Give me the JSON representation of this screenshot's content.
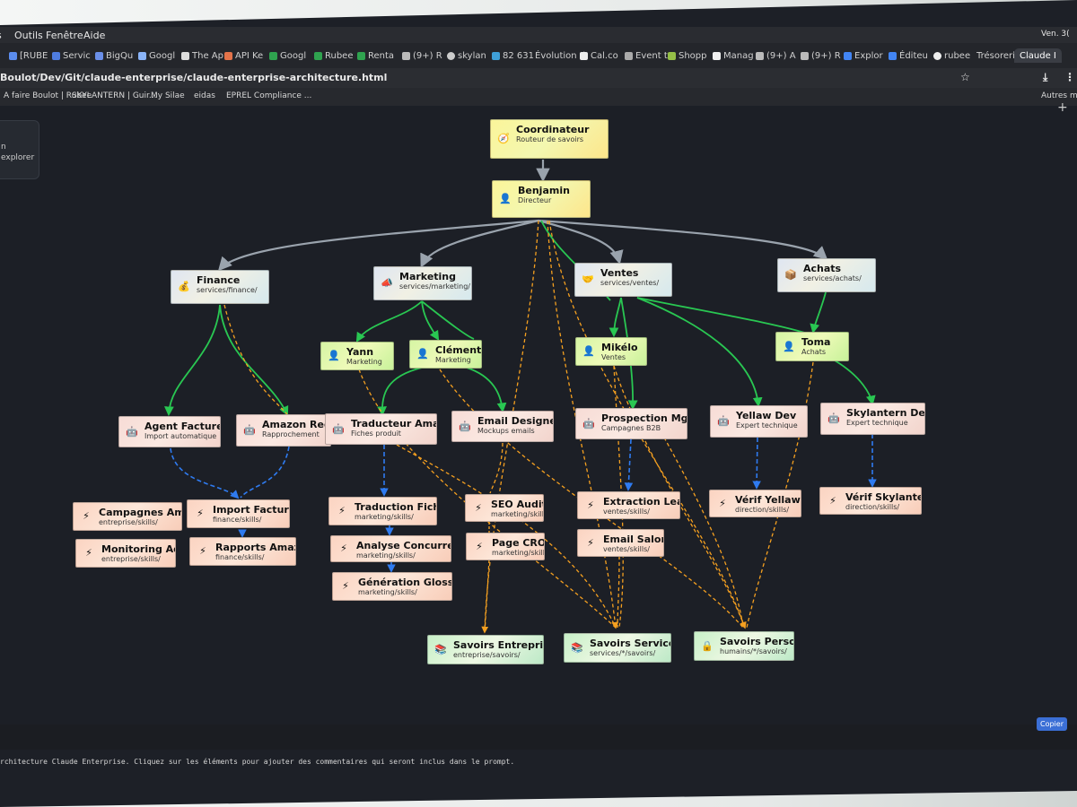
{
  "menubar": {
    "items": [
      "s",
      "Outils",
      "Fenêtre",
      "Aide"
    ],
    "clock": "Ven. 3("
  },
  "tabs": [
    {
      "label": "[RUBE"
    },
    {
      "label": "Servic"
    },
    {
      "label": "BigQu"
    },
    {
      "label": "Googl"
    },
    {
      "label": "The Ap"
    },
    {
      "label": "API Ke"
    },
    {
      "label": "Googl"
    },
    {
      "label": "Rubee"
    },
    {
      "label": "Renta"
    },
    {
      "label": "(9+) R"
    },
    {
      "label": "skylan"
    },
    {
      "label": "82 631"
    },
    {
      "label": "Évolution d"
    },
    {
      "label": "Cal.co"
    },
    {
      "label": "Event t"
    },
    {
      "label": "Shopp"
    },
    {
      "label": "Manag"
    },
    {
      "label": "(9+) A"
    },
    {
      "label": "(9+) R"
    },
    {
      "label": "Explor"
    },
    {
      "label": "Éditeu"
    },
    {
      "label": "rubee"
    },
    {
      "label": "Trésorerie"
    },
    {
      "label": "Claude I"
    }
  ],
  "address": {
    "url": "Boulot/Dev/Git/claude-enterprise/claude-enterprise-architecture.html"
  },
  "bookmarks": [
    "A faire Boulot | Rubee",
    "SKYLANTERN | Guir...",
    "My Silae",
    "eidas",
    "EPREL Compliance ..."
  ],
  "bookmarks_other": "Autres m",
  "side_panel": {
    "line1": "n",
    "line2": "explorer"
  },
  "nodes": {
    "coord": {
      "title": "Coordinateur",
      "sub": "Routeur de savoirs"
    },
    "benjamin": {
      "title": "Benjamin",
      "sub": "Directeur"
    },
    "finance": {
      "title": "Finance",
      "sub": "services/finance/"
    },
    "marketing": {
      "title": "Marketing",
      "sub": "services/marketing/"
    },
    "ventes": {
      "title": "Ventes",
      "sub": "services/ventes/"
    },
    "achats": {
      "title": "Achats",
      "sub": "services/achats/"
    },
    "yann": {
      "title": "Yann",
      "sub": "Marketing"
    },
    "clement": {
      "title": "Clément",
      "sub": "Marketing"
    },
    "mikelo": {
      "title": "Mikélo",
      "sub": "Ventes"
    },
    "toma": {
      "title": "Toma",
      "sub": "Achats"
    },
    "agent_factures": {
      "title": "Agent Factures",
      "sub": "Import automatique"
    },
    "amazon_reco": {
      "title": "Amazon Reco",
      "sub": "Rapprochement"
    },
    "traducteur": {
      "title": "Traducteur Amazon",
      "sub": "Fiches produit"
    },
    "email_designer": {
      "title": "Email Designer",
      "sub": "Mockups emails"
    },
    "prospection": {
      "title": "Prospection Mgr",
      "sub": "Campagnes B2B"
    },
    "yellaw_dev": {
      "title": "Yellaw Dev",
      "sub": "Expert technique"
    },
    "skylantern_dev": {
      "title": "Skylantern Dev",
      "sub": "Expert technique"
    },
    "campagnes": {
      "title": "Campagnes Amazo",
      "sub": "entreprise/skills/"
    },
    "monitoring": {
      "title": "Monitoring Ads",
      "sub": "entreprise/skills/"
    },
    "import_factures": {
      "title": "Import Factures",
      "sub": "finance/skills/"
    },
    "rapports": {
      "title": "Rapports Amazon",
      "sub": "finance/skills/"
    },
    "traduction": {
      "title": "Traduction Fiche",
      "sub": "marketing/skills/"
    },
    "analyse": {
      "title": "Analyse Concurrence",
      "sub": "marketing/skills/"
    },
    "glossaire": {
      "title": "Génération Glossaire",
      "sub": "marketing/skills/"
    },
    "seo": {
      "title": "SEO Audit",
      "sub": "marketing/skills/"
    },
    "cro": {
      "title": "Page CRO",
      "sub": "marketing/skills/"
    },
    "extraction": {
      "title": "Extraction Leads",
      "sub": "ventes/skills/"
    },
    "email_salon": {
      "title": "Email Salon",
      "sub": "ventes/skills/"
    },
    "verif_yellaw": {
      "title": "Vérif Yellaw",
      "sub": "direction/skills/"
    },
    "verif_sky": {
      "title": "Vérif Skylantern",
      "sub": "direction/skills/"
    },
    "sav_ent": {
      "title": "Savoirs Entreprise",
      "sub": "entreprise/savoirs/"
    },
    "sav_serv": {
      "title": "Savoirs Service",
      "sub": "services/*/savoirs/"
    },
    "sav_perso": {
      "title": "Savoirs Perso",
      "sub": "humains/*/savoirs/"
    }
  },
  "copy_label": "Copier",
  "status_text": "rchitecture Claude Enterprise. Cliquez sur les éléments pour ajouter des commentaires qui seront inclus dans le prompt."
}
